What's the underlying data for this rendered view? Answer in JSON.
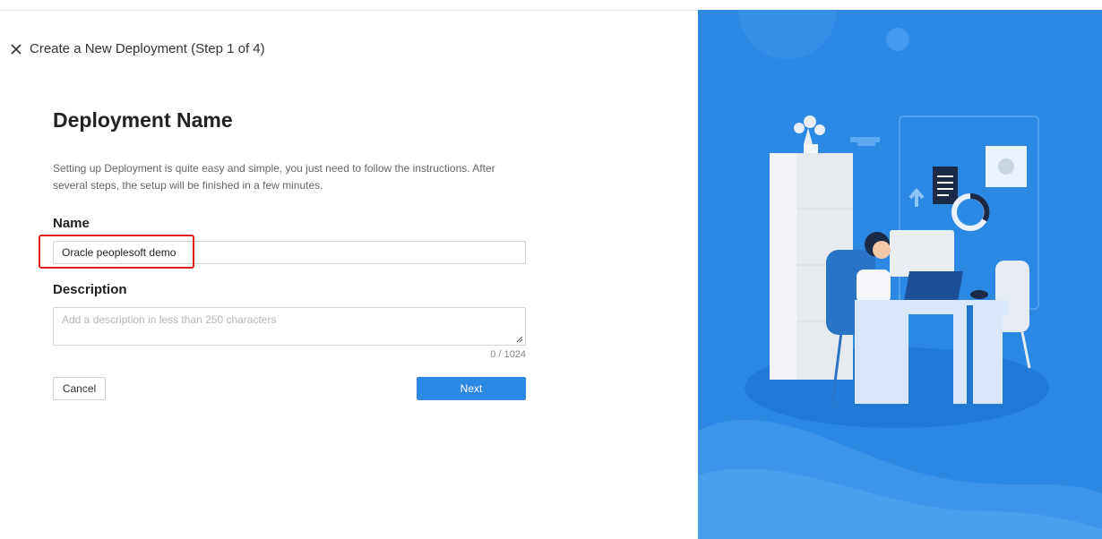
{
  "header": {
    "title": "Create a New Deployment (Step 1 of 4)",
    "close_icon": "close-icon"
  },
  "form": {
    "page_title": "Deployment Name",
    "intro": "Setting up Deployment is quite easy and simple, you just need to follow the instructions. After several steps, the setup will be finished in a few minutes.",
    "name_label": "Name",
    "name_value": "Oracle peoplesoft demo",
    "description_label": "Description",
    "description_placeholder": "Add a description in less than 250 characters",
    "description_counter": "0 / 1024"
  },
  "actions": {
    "cancel_label": "Cancel",
    "next_label": "Next"
  },
  "colors": {
    "primary": "#2b88e3",
    "illustration_bg": "#2b88e3",
    "highlight": "#e02020"
  }
}
